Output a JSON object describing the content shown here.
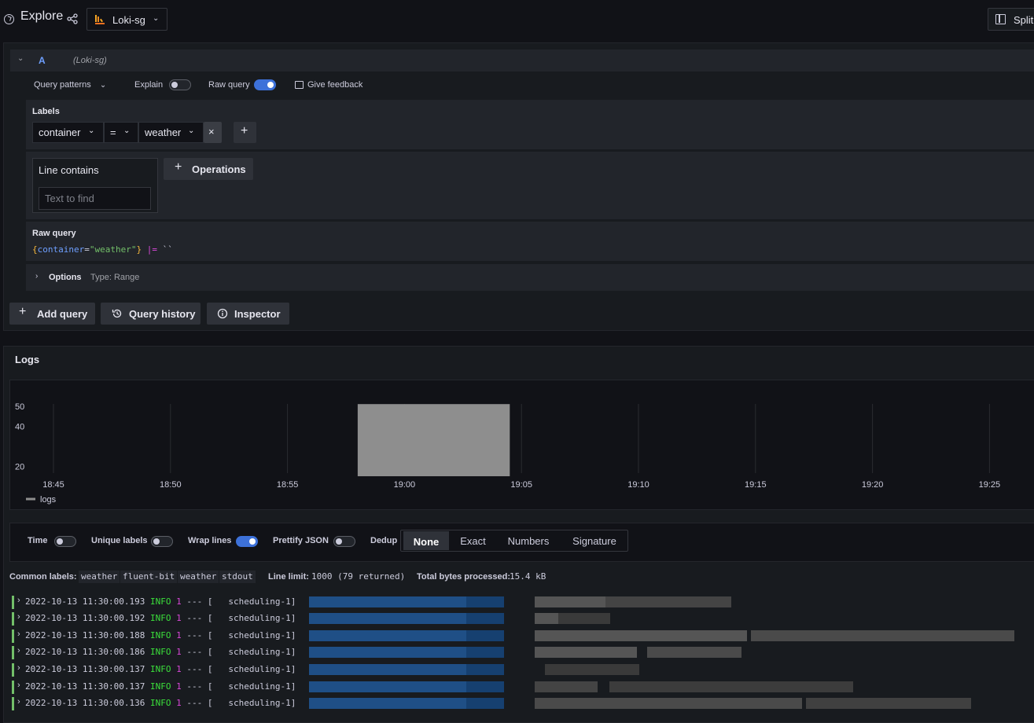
{
  "header": {
    "title": "Explore",
    "datasource": "Loki-sg",
    "split_label": "Split"
  },
  "query_row": {
    "letter": "A",
    "datasource_ref": "(Loki-sg)",
    "query_patterns": "Query patterns",
    "explain_label": "Explain",
    "explain_on": false,
    "raw_query_label": "Raw query",
    "raw_query_on": true,
    "feedback_label": "Give feedback"
  },
  "labels_section": {
    "title": "Labels",
    "label_name": "container",
    "operator": "=",
    "label_value": "weather",
    "remove_symbol": "×",
    "add_symbol": "+"
  },
  "line_contains": {
    "title": "Line contains",
    "placeholder": "Text to find",
    "operations_label": "Operations"
  },
  "raw_query": {
    "title": "Raw query",
    "open_brace": "{",
    "label_key": "container",
    "equals": "=",
    "label_val": "\"weather\"",
    "close_brace": "}",
    "pipe_op": "|=",
    "backticks": "``"
  },
  "options": {
    "label": "Options",
    "type_text": "Type: Range"
  },
  "actions": {
    "add_query": "Add query",
    "query_history": "Query history",
    "inspector": "Inspector"
  },
  "logs": {
    "title": "Logs",
    "legend": "logs",
    "time_label": "Time",
    "time_on": false,
    "unique_labels_label": "Unique labels",
    "unique_labels_on": false,
    "wrap_lines_label": "Wrap lines",
    "wrap_lines_on": true,
    "prettify_json_label": "Prettify JSON",
    "prettify_json_on": false,
    "dedup_label": "Dedup",
    "dedup_options": [
      "None",
      "Exact",
      "Numbers",
      "Signature"
    ],
    "dedup_selected": "None",
    "common_labels_label": "Common labels:",
    "common_labels": [
      "weather",
      "fluent-bit",
      "weather",
      "stdout"
    ],
    "line_limit_label": "Line limit:",
    "line_limit_value": "1000 (79 returned)",
    "bytes_label": "Total bytes processed:",
    "bytes_value": "15.4 kB",
    "rows": [
      {
        "ts": "2022-10-13 11:30:00.193",
        "level": "INFO",
        "pid": "1",
        "sep": "--- [",
        "thread": "scheduling-1]"
      },
      {
        "ts": "2022-10-13 11:30:00.192",
        "level": "INFO",
        "pid": "1",
        "sep": "--- [",
        "thread": "scheduling-1]"
      },
      {
        "ts": "2022-10-13 11:30:00.188",
        "level": "INFO",
        "pid": "1",
        "sep": "--- [",
        "thread": "scheduling-1]"
      },
      {
        "ts": "2022-10-13 11:30:00.186",
        "level": "INFO",
        "pid": "1",
        "sep": "--- [",
        "thread": "scheduling-1]"
      },
      {
        "ts": "2022-10-13 11:30:00.137",
        "level": "INFO",
        "pid": "1",
        "sep": "--- [",
        "thread": "scheduling-1]"
      },
      {
        "ts": "2022-10-13 11:30:00.137",
        "level": "INFO",
        "pid": "1",
        "sep": "--- [",
        "thread": "scheduling-1]"
      },
      {
        "ts": "2022-10-13 11:30:00.136",
        "level": "INFO",
        "pid": "1",
        "sep": "--- [",
        "thread": "scheduling-1]"
      }
    ]
  },
  "chart_data": {
    "type": "bar",
    "x_ticks": [
      "18:45",
      "18:50",
      "18:55",
      "19:00",
      "19:05",
      "19:10",
      "19:15",
      "19:20",
      "19:25"
    ],
    "y_ticks": [
      "20",
      "40",
      "50"
    ],
    "series": [
      {
        "name": "logs",
        "bars": [
          {
            "start": "18:58",
            "end": "19:04:30",
            "value": 51
          }
        ]
      }
    ],
    "ylim": [
      15,
      55
    ],
    "bar_color": "#8e8e8e",
    "grid": true,
    "legend": "bottom-left"
  }
}
